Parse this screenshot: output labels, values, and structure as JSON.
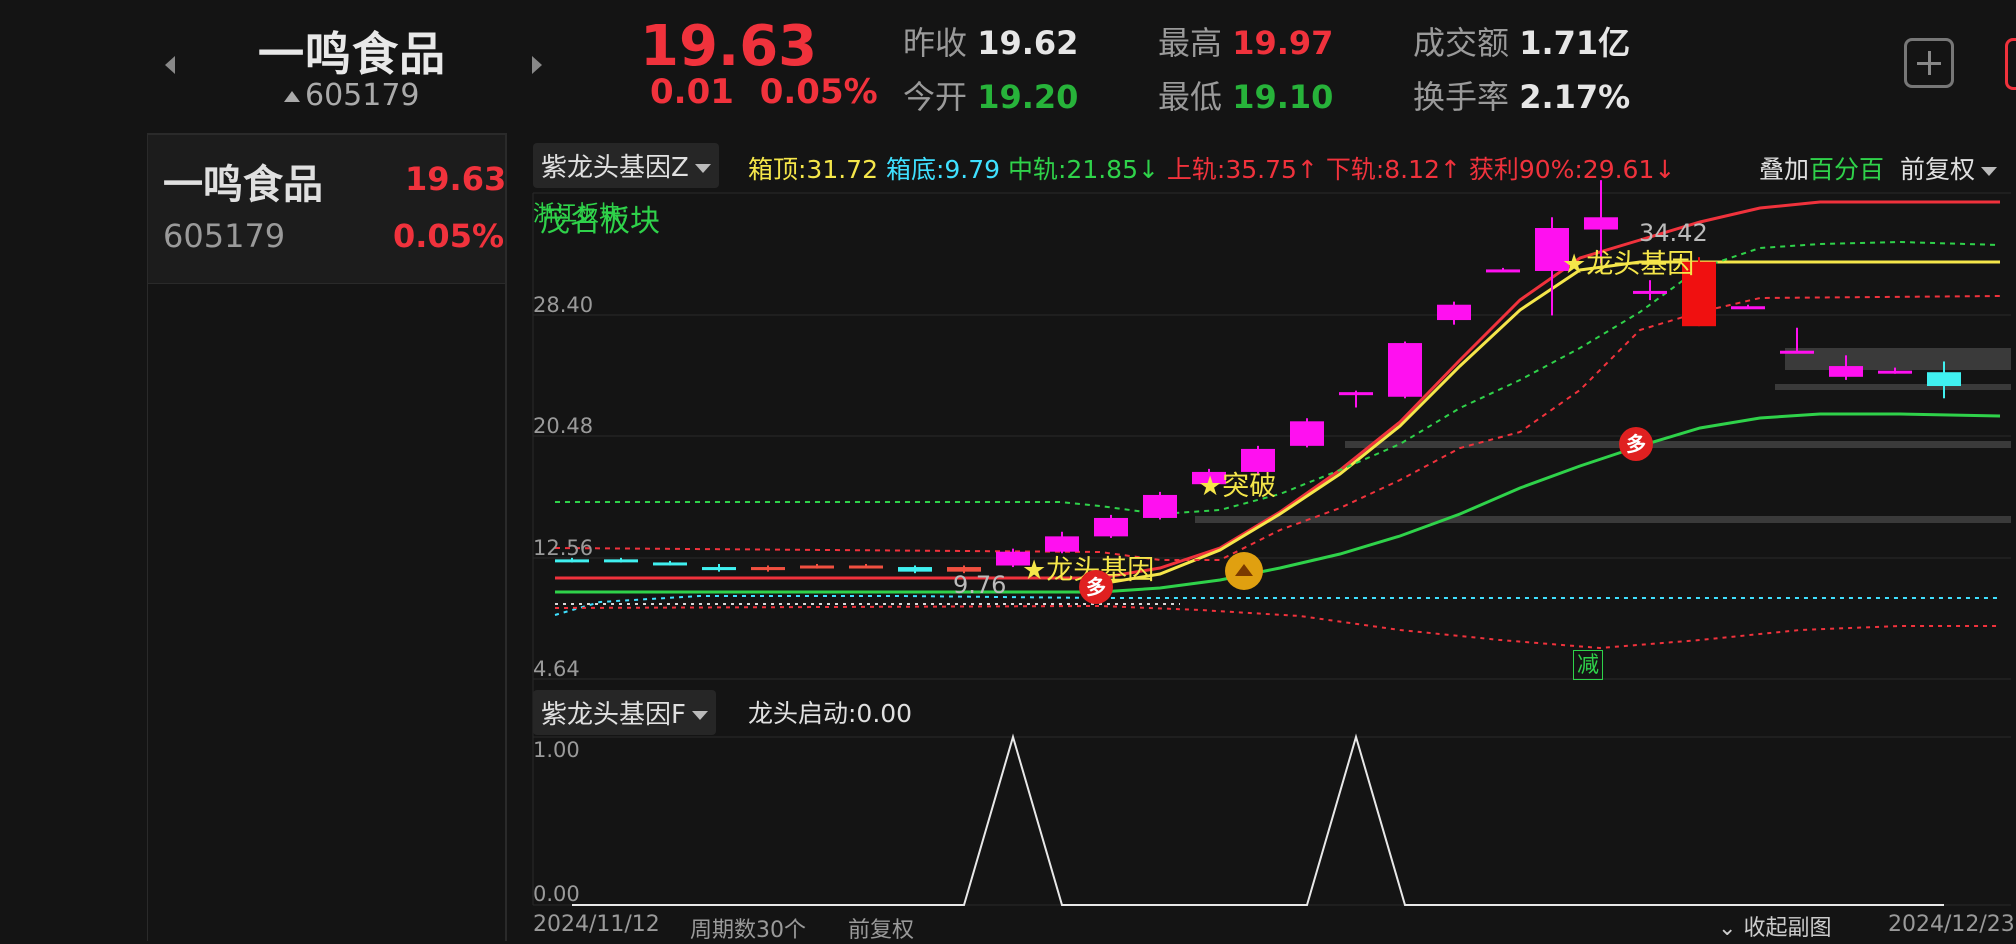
{
  "header": {
    "stock_name": "一鸣食品",
    "stock_code": "605179",
    "price": "19.63",
    "change": "0.01",
    "change_pct": "0.05%",
    "stats": [
      {
        "label": "昨收",
        "value": "19.62",
        "color": "#e6e6e6"
      },
      {
        "label": "最高",
        "value": "19.97",
        "color": "#f0323c"
      },
      {
        "label": "成交额",
        "value": "1.71亿",
        "color": "#e6e6e6"
      },
      {
        "label": "今开",
        "value": "19.20",
        "color": "#27b33a"
      },
      {
        "label": "最低",
        "value": "19.10",
        "color": "#27b33a"
      },
      {
        "label": "换手率",
        "value": "2.17%",
        "color": "#e6e6e6"
      }
    ]
  },
  "watchlist": [
    {
      "name": "一鸣食品",
      "price": "19.63",
      "code": "605179",
      "pct": "0.05%"
    }
  ],
  "main_chart": {
    "indicator": "紫龙头基因Z",
    "values": [
      {
        "text": "箱顶:31.72",
        "color": "#f5e64a"
      },
      {
        "text": "箱底:9.79",
        "color": "#3fe0ff"
      },
      {
        "text": "中轨:21.85↓",
        "color": "#2fd24a"
      },
      {
        "text": "上轨:35.75↑",
        "color": "#f0323c"
      },
      {
        "text": "下轨:8.12↑",
        "color": "#f0323c"
      },
      {
        "text": "获利90%:29.61↓",
        "color": "#f0323c"
      }
    ],
    "overlay_label": "叠加",
    "overlay_label2": "百分百",
    "adjust_label": "前复权",
    "sector_label1": "茂名板块",
    "sector_label2": "浙江板块:",
    "sector_prefix": "34.",
    "y_ticks": [
      "28.40",
      "20.48",
      "12.56",
      "4.64"
    ],
    "high_mark": "34.42",
    "low_mark": "9.76",
    "annotations": [
      "★龙头基因",
      "★突破",
      "★龙头基因"
    ],
    "signal_duo": "多",
    "signal_jian": "减",
    "chart_data": {
      "type": "candlestick",
      "ylim": [
        4.64,
        36.32
      ],
      "dates_first": "2024/11/12",
      "dates_last": "2024/12/23",
      "candles": [
        {
          "o": 9.7,
          "c": 9.6,
          "h": 9.8,
          "l": 9.5
        },
        {
          "o": 9.7,
          "c": 9.6,
          "h": 9.8,
          "l": 9.5
        },
        {
          "o": 9.5,
          "c": 9.4,
          "h": 9.6,
          "l": 9.3
        },
        {
          "o": 9.2,
          "c": 9.0,
          "h": 9.4,
          "l": 8.9
        },
        {
          "o": 9.0,
          "c": 9.2,
          "h": 9.3,
          "l": 8.9
        },
        {
          "o": 9.2,
          "c": 9.3,
          "h": 9.4,
          "l": 9.1
        },
        {
          "o": 9.3,
          "c": 9.3,
          "h": 9.4,
          "l": 9.2
        },
        {
          "o": 9.2,
          "c": 8.9,
          "h": 9.3,
          "l": 8.8
        },
        {
          "o": 8.9,
          "c": 9.2,
          "h": 9.3,
          "l": 8.8
        },
        {
          "o": 9.3,
          "c": 10.2,
          "h": 10.4,
          "l": 9.2
        },
        {
          "o": 10.2,
          "c": 11.2,
          "h": 11.5,
          "l": 10.1
        },
        {
          "o": 11.2,
          "c": 12.4,
          "h": 12.6,
          "l": 11.1
        },
        {
          "o": 12.4,
          "c": 13.9,
          "h": 14.1,
          "l": 12.3
        },
        {
          "o": 14.6,
          "c": 15.4,
          "h": 15.6,
          "l": 14.5
        },
        {
          "o": 15.4,
          "c": 16.9,
          "h": 17.1,
          "l": 15.3
        },
        {
          "o": 17.1,
          "c": 18.7,
          "h": 18.9,
          "l": 17.0
        },
        {
          "o": 20.6,
          "c": 20.6,
          "h": 20.7,
          "l": 19.6
        },
        {
          "o": 20.3,
          "c": 23.8,
          "h": 23.9,
          "l": 20.2
        },
        {
          "o": 25.3,
          "c": 26.3,
          "h": 26.5,
          "l": 25.0
        },
        {
          "o": 28.6,
          "c": 28.6,
          "h": 28.7,
          "l": 28.5
        },
        {
          "o": 28.5,
          "c": 31.3,
          "h": 32.0,
          "l": 25.6
        },
        {
          "o": 31.2,
          "c": 32.0,
          "h": 34.42,
          "l": 29.0
        },
        {
          "o": 27.2,
          "c": 27.2,
          "h": 27.9,
          "l": 26.6
        },
        {
          "o": 29.1,
          "c": 24.9,
          "h": 29.4,
          "l": 24.9
        },
        {
          "o": 26.2,
          "c": 26.2,
          "h": 26.3,
          "l": 26.1
        },
        {
          "o": 23.3,
          "c": 23.3,
          "h": 24.8,
          "l": 23.2
        },
        {
          "o": 21.6,
          "c": 22.3,
          "h": 23.0,
          "l": 21.4
        },
        {
          "o": 21.9,
          "c": 22.0,
          "h": 22.2,
          "l": 21.8
        },
        {
          "o": 21.9,
          "c": 21.0,
          "h": 22.6,
          "l": 20.2
        }
      ]
    }
  },
  "sub_chart": {
    "indicator": "紫龙头基因F",
    "value_text": "龙头启动:0.00",
    "y_ticks": [
      "1.00",
      "0.00"
    ],
    "chart_data": {
      "type": "line",
      "values": [
        0,
        0,
        0,
        0,
        0,
        0,
        0,
        0,
        0,
        1,
        0,
        0,
        0,
        0,
        0,
        0,
        1,
        0,
        0,
        0,
        0,
        0,
        0,
        0,
        0,
        0,
        0,
        0,
        0
      ],
      "ylim": [
        0,
        1
      ]
    }
  },
  "footer": {
    "date_start": "2024/11/12",
    "period": "周期数30个",
    "adjust": "前复权",
    "collapse": "收起副图",
    "date_end": "2024/12/23"
  }
}
